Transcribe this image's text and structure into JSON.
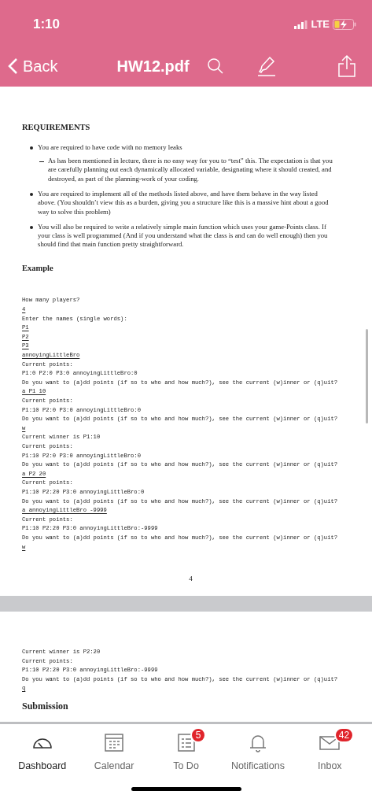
{
  "status_bar": {
    "time": "1:10",
    "network": "LTE"
  },
  "nav_bar": {
    "back": "Back",
    "title": "HW12.pdf"
  },
  "page_1": {
    "heading": "REQUIREMENTS",
    "bullets": [
      {
        "text": "You are required to have code with no memory leaks",
        "children": [
          {
            "text": "As has been mentioned in lecture, there is no easy way for you to “test” this. The expectation is that you are carefully planning out each dynamically allocated variable, designating where it should created, and destroyed, as part of the planning-work of your coding."
          }
        ]
      },
      {
        "text": "You are required to implement all of the methods listed above, and have them behave in the way listed above. (You shouldn’t view this as a burden, giving you a structure like this is a massive hint about a good way to solve this problem)"
      },
      {
        "text": "You will also be required to write a relatively simple main function which uses your game-Points class. If your class is well programmed (And if you understand what the class is and can do well enough) then you should find that main function pretty straightforward."
      }
    ],
    "subheading": "Example",
    "code_lines": [
      {
        "kind": "output",
        "text": "How many players?"
      },
      {
        "kind": "input",
        "text": "4"
      },
      {
        "kind": "output",
        "text": "Enter the names (single words):"
      },
      {
        "kind": "input",
        "text": "P1"
      },
      {
        "kind": "input",
        "text": "P2"
      },
      {
        "kind": "input",
        "text": "P3"
      },
      {
        "kind": "input",
        "text": "annoyingLittleBro"
      },
      {
        "kind": "output",
        "text": "Current points:"
      },
      {
        "kind": "output",
        "text": "P1:0 P2:0 P3:0 annoyingLittleBro:0"
      },
      {
        "kind": "output",
        "text": "Do you want to (a)dd points (if so to who and how much?), see the current (w)inner or (q)uit?"
      },
      {
        "kind": "input",
        "text": "a P1 10"
      },
      {
        "kind": "output",
        "text": "Current points:"
      },
      {
        "kind": "output",
        "text": "P1:10 P2:0 P3:0 annoyingLittleBro:0"
      },
      {
        "kind": "output",
        "text": "Do you want to (a)dd points (if so to who and how much?), see the current (w)inner or (q)uit?"
      },
      {
        "kind": "input",
        "text": "w"
      },
      {
        "kind": "output",
        "text": "Current winner is P1:10"
      },
      {
        "kind": "output",
        "text": "Current points:"
      },
      {
        "kind": "output",
        "text": "P1:10 P2:0 P3:0 annoyingLittleBro:0"
      },
      {
        "kind": "output",
        "text": "Do you want to (a)dd points (if so to who and how much?), see the current (w)inner or (q)uit?"
      },
      {
        "kind": "input",
        "text": "a P2 20"
      },
      {
        "kind": "output",
        "text": "Current points:"
      },
      {
        "kind": "output",
        "text": "P1:10 P2:20 P3:0 annoyingLittleBro:0"
      },
      {
        "kind": "output",
        "text": "Do you want to (a)dd points (if so to who and how much?), see the current (w)inner or (q)uit?"
      },
      {
        "kind": "input",
        "text": "a annoyingLittleBro -9999"
      },
      {
        "kind": "output",
        "text": "Current points:"
      },
      {
        "kind": "output",
        "text": "P1:10 P2:20 P3:0 annoyingLittleBro:-9999"
      },
      {
        "kind": "output",
        "text": "Do you want to (a)dd points (if so to who and how much?), see the current (w)inner or (q)uit?"
      },
      {
        "kind": "input",
        "text": "w"
      }
    ],
    "page_number": "4"
  },
  "page_2": {
    "code_lines": [
      {
        "kind": "output",
        "text": "Current winner is P2:20"
      },
      {
        "kind": "output",
        "text": "Current points:"
      },
      {
        "kind": "output",
        "text": "P1:10 P2:20 P3:0 annoyingLittleBro:-9999"
      },
      {
        "kind": "output",
        "text": "Do you want to (a)dd points (if so to who and how much?), see the current (w)inner or (q)uit?"
      },
      {
        "kind": "input",
        "text": "q"
      }
    ],
    "section_heading": "Submission"
  },
  "tab_bar": [
    {
      "kind": "dashboard",
      "label": "Dashboard",
      "selected": true
    },
    {
      "kind": "calendar",
      "label": "Calendar",
      "selected": false
    },
    {
      "kind": "todo",
      "label": "To Do",
      "selected": false,
      "badge": "5"
    },
    {
      "kind": "notifications",
      "label": "Notifications",
      "selected": false
    },
    {
      "kind": "inbox",
      "label": "Inbox",
      "selected": false,
      "badge": "42"
    }
  ]
}
